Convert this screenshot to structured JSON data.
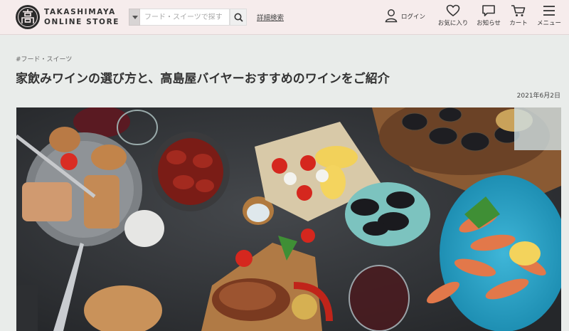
{
  "header": {
    "logo_line1": "TAKASHIMAYA",
    "logo_line2": "ONLINE STORE",
    "search_placeholder": "フード・スイーツで探す",
    "advanced_search_label": "詳細検索",
    "login_label": "ログイン",
    "favorites_label": "お気に入り",
    "notices_label": "お知らせ",
    "cart_label": "カート",
    "menu_label": "メニュー"
  },
  "article": {
    "category": "#フード・スイーツ",
    "title": "家飲みワインの選び方と、高島屋バイヤーおすすめのワインをご紹介",
    "date": "2021年6月2日"
  },
  "colors": {
    "header_bg": "#f6ecec",
    "page_bg": "#e9ecea",
    "text": "#333333"
  }
}
